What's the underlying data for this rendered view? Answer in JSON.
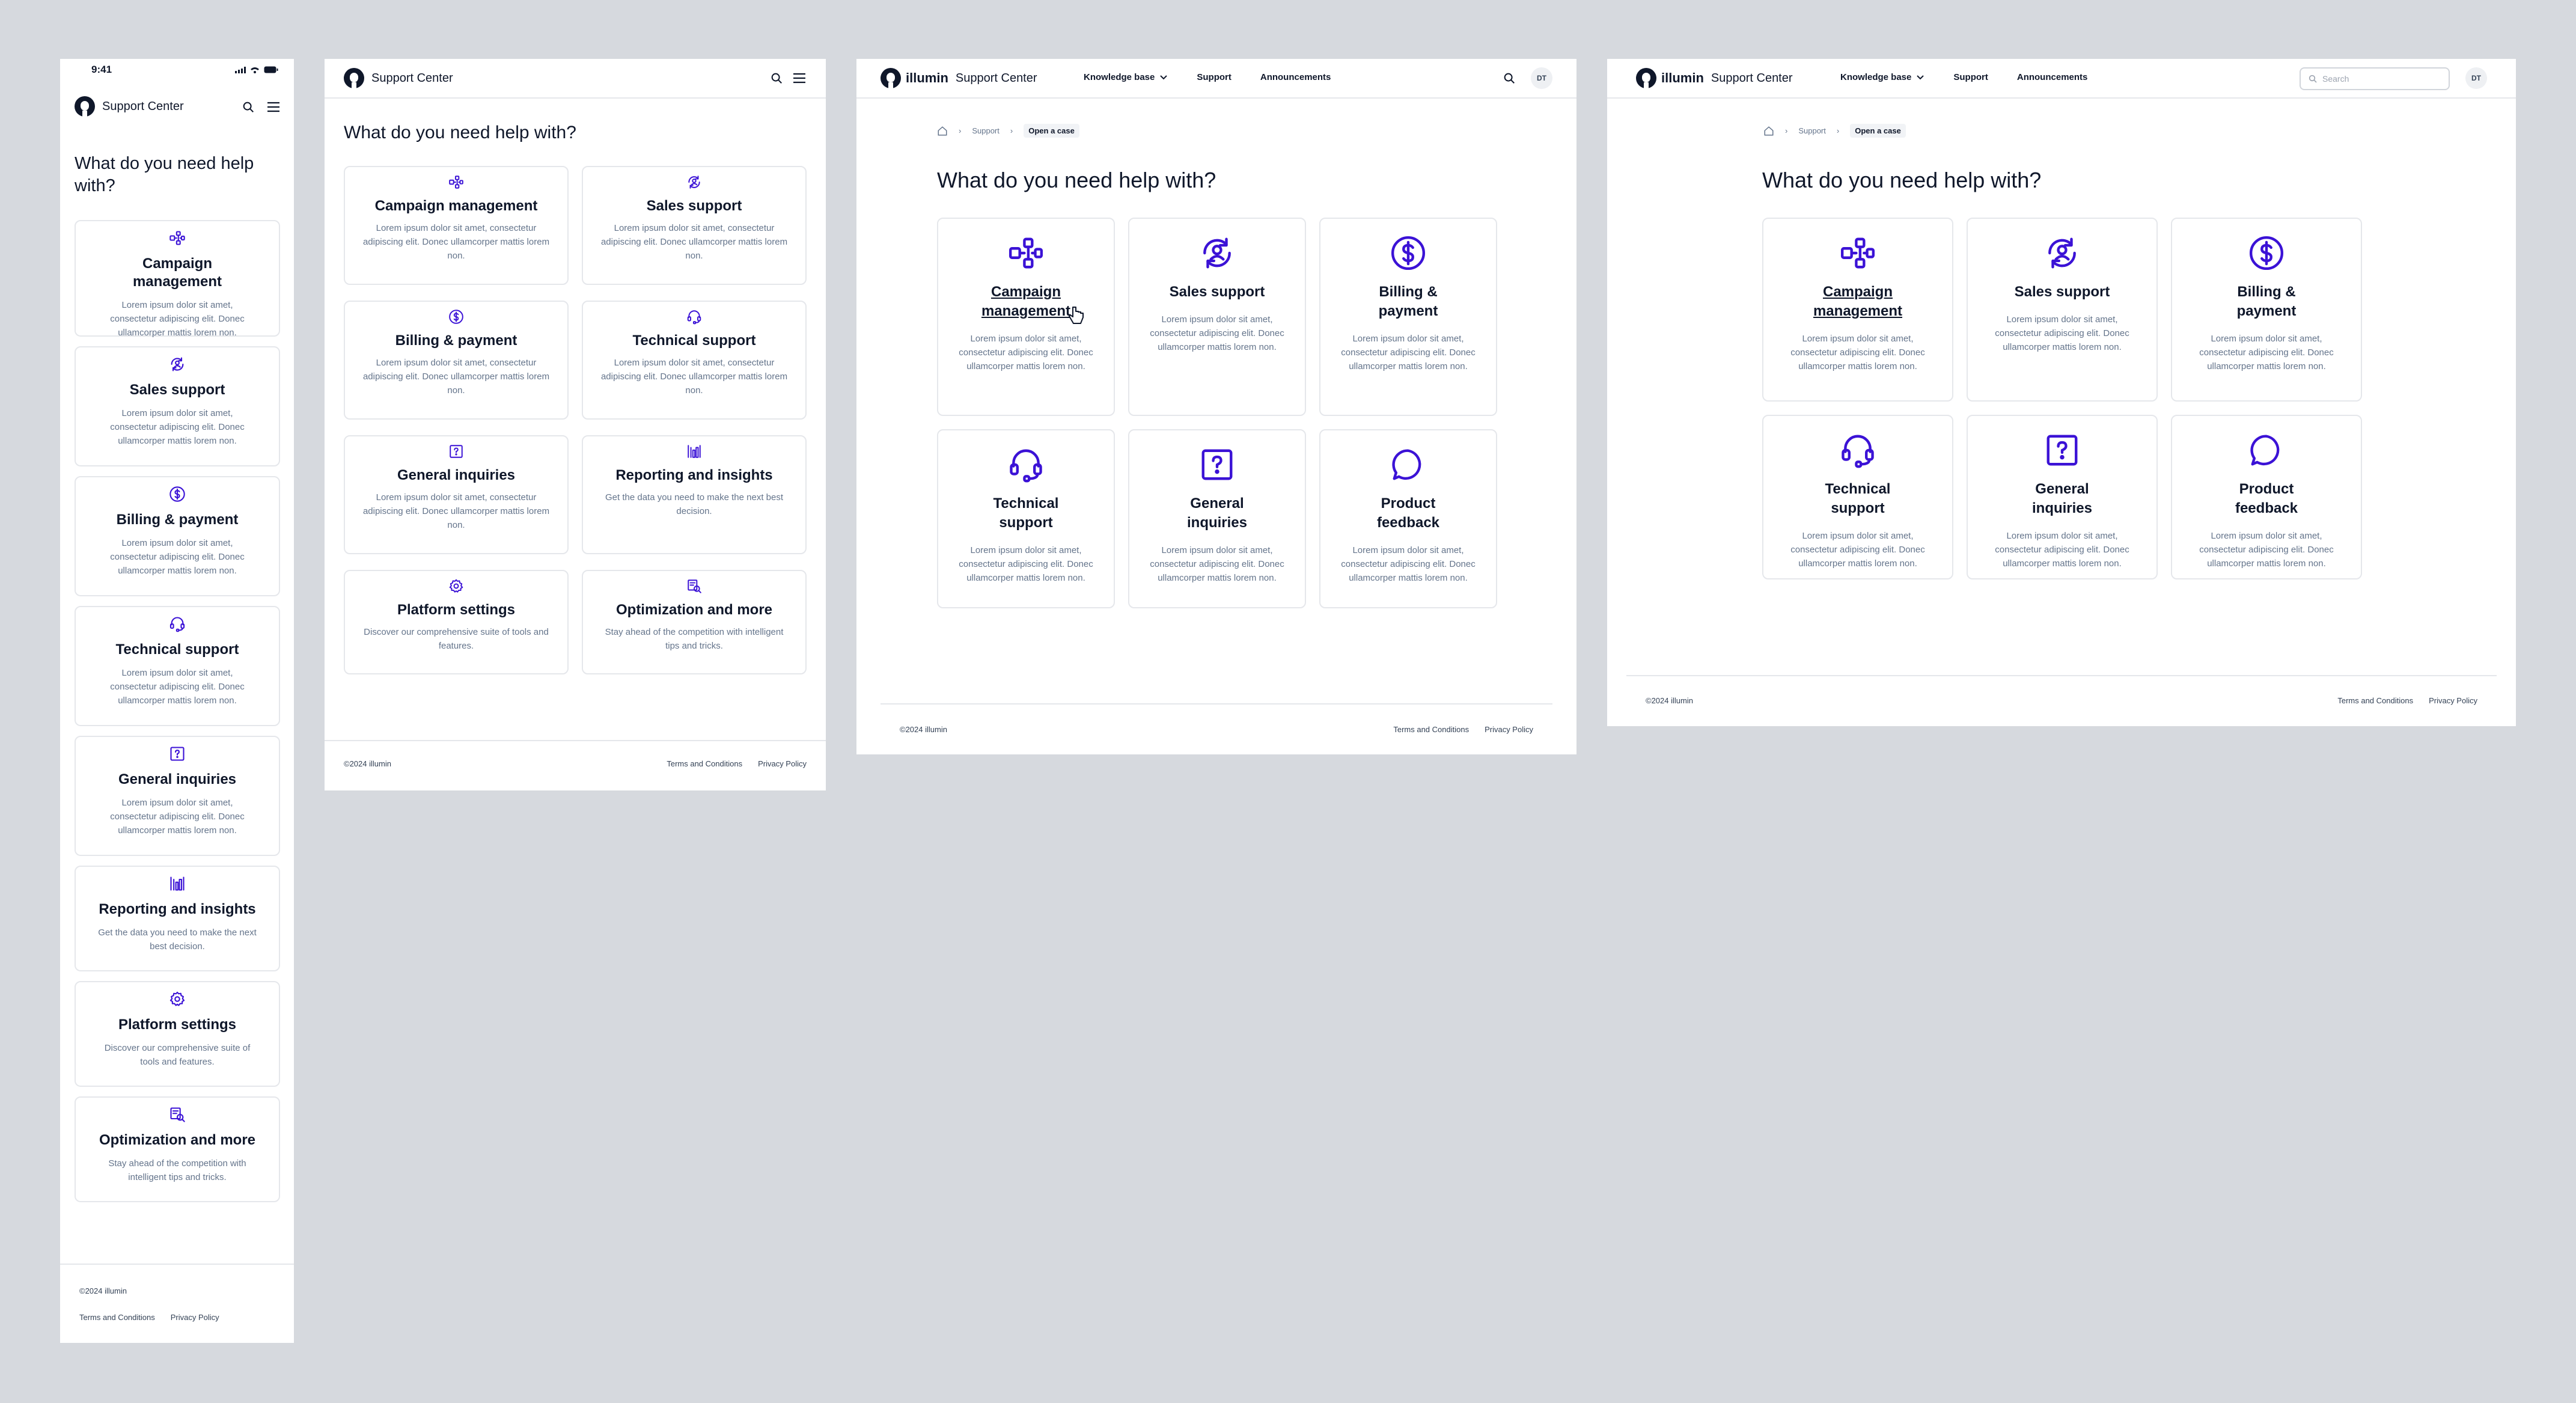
{
  "mobile": {
    "status_time": "9:41",
    "app_name": "Support Center",
    "heading": "What do you need help with?",
    "copyright": "©2024 illumin",
    "terms": "Terms and Conditions",
    "privacy": "Privacy Policy"
  },
  "tablet": {
    "app_name": "Support Center",
    "heading": "What do you need help with?",
    "copyright": "©2024 illumin",
    "terms": "Terms and Conditions",
    "privacy": "Privacy Policy"
  },
  "desktop": {
    "brand": "illumin",
    "app_name": "Support Center",
    "nav": [
      "Knowledge base",
      "Support",
      "Announcements"
    ],
    "avatar": "DT",
    "search_placeholder": "Search",
    "breadcrumb": [
      "Support",
      "Open a case"
    ],
    "heading": "What do you need help with?",
    "copyright": "©2024 illumin",
    "terms": "Terms and Conditions",
    "privacy": "Privacy Policy"
  },
  "categories": [
    {
      "title": "Campaign management",
      "desc": "Lorem ipsum dolor sit amet, consectetur adipiscing elit. Donec ullamcorper mattis lorem non.",
      "icon": "campaign-icon"
    },
    {
      "title": "Sales support",
      "desc": "Lorem ipsum dolor sit amet, consectetur adipiscing elit. Donec ullamcorper mattis lorem non.",
      "icon": "sales-support-icon"
    },
    {
      "title": "Billing & payment",
      "desc": "Lorem ipsum dolor sit amet, consectetur adipiscing elit. Donec ullamcorper mattis lorem non.",
      "icon": "dollar-icon"
    },
    {
      "title": "Technical support",
      "desc": "Lorem ipsum dolor sit amet, consectetur adipiscing elit. Donec ullamcorper mattis lorem non.",
      "icon": "headset-icon"
    },
    {
      "title": "General inquiries",
      "desc": "Lorem ipsum dolor sit amet, consectetur adipiscing elit. Donec ullamcorper mattis lorem non.",
      "icon": "question-icon"
    },
    {
      "title": "Reporting and insights",
      "desc": "Get the data you need to make the next best decision.",
      "icon": "chart-icon"
    },
    {
      "title": "Platform settings",
      "desc": "Discover our comprehensive suite of tools and features.",
      "icon": "gear-icon"
    },
    {
      "title": "Optimization and more",
      "desc": "Stay ahead of the competition with intelligent tips and tricks.",
      "icon": "optimization-icon"
    },
    {
      "title": "Product feedback",
      "desc": "Lorem ipsum dolor sit amet, consectetur adipiscing elit. Donec ullamcorper mattis lorem non.",
      "icon": "chat-bubble-icon"
    }
  ],
  "colors": {
    "accent": "#3b12d6",
    "text": "#0f172a",
    "muted": "#64748b",
    "border": "#e5e7eb",
    "canvas": "#d6d9de"
  }
}
